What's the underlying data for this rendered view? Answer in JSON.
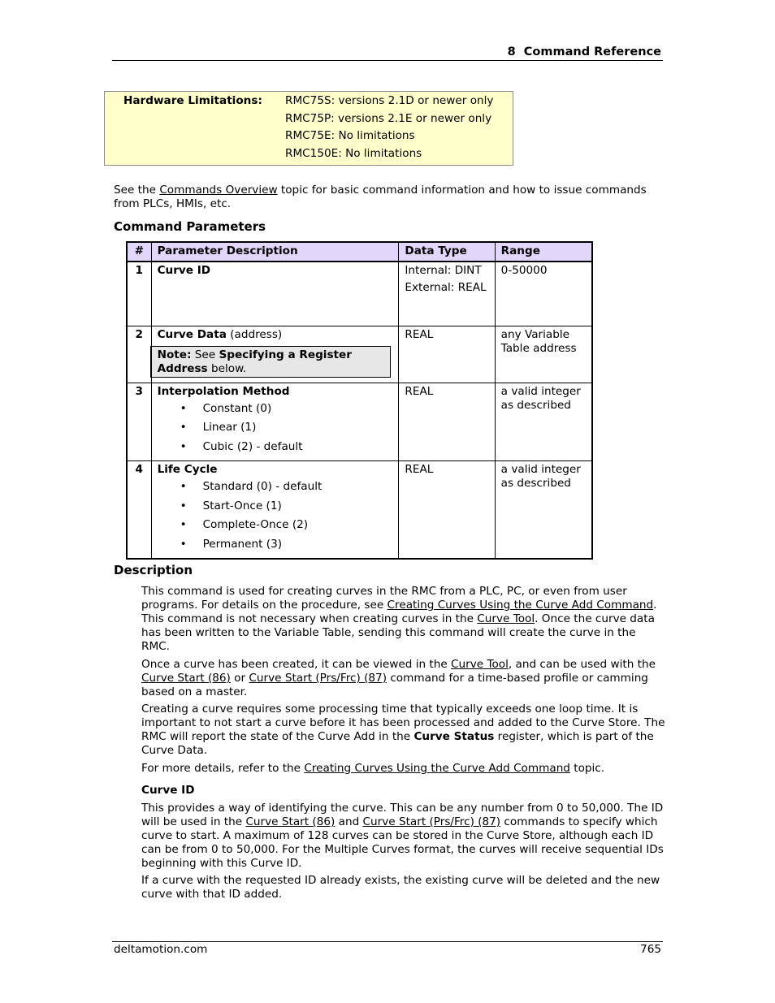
{
  "header": {
    "chapter_title": "8  Command Reference"
  },
  "hardware": {
    "label": "Hardware Limitations:",
    "items": [
      "RMC75S: versions 2.1D or newer only",
      "RMC75P: versions 2.1E or newer only",
      "RMC75E: No limitations",
      "RMC150E: No limitations"
    ]
  },
  "intro": {
    "before": "See the ",
    "link": "Commands Overview",
    "after": " topic for basic command information and how to issue commands from PLCs, HMIs, etc."
  },
  "command_parameters": {
    "heading": "Command Parameters",
    "columns": [
      "#",
      "Parameter Description",
      "Data Type",
      "Range"
    ],
    "rows": [
      {
        "num": "1",
        "name": "Curve ID",
        "data_type": [
          "Internal: DINT",
          "External: REAL"
        ],
        "range": "0-50000"
      },
      {
        "num": "2",
        "name": "Curve Data",
        "name_suffix": " (address)",
        "note": {
          "label": "Note:",
          "pre": " See ",
          "bold": "Specifying a Register Address",
          "post": " below."
        },
        "data_type": [
          "REAL"
        ],
        "range": "any Variable Table address"
      },
      {
        "num": "3",
        "name": "Interpolation Method",
        "options": [
          "Constant (0)",
          "Linear (1)",
          "Cubic (2) - default"
        ],
        "data_type": [
          "REAL"
        ],
        "range": "a valid integer as described"
      },
      {
        "num": "4",
        "name": "Life Cycle",
        "options": [
          "Standard (0) - default",
          "Start-Once (1)",
          "Complete-Once (2)",
          "Permanent (3)"
        ],
        "data_type": [
          "REAL"
        ],
        "range": "a valid integer as described"
      }
    ]
  },
  "description": {
    "heading": "Description",
    "p1": {
      "t1": "This command is used for creating curves in the RMC from a PLC, PC, or even from user programs. For details on the procedure, see ",
      "l1": "Creating Curves Using the Curve Add Command",
      "t2": ". This command is not necessary when creating curves in the ",
      "l2": "Curve Tool",
      "t3": ". Once the curve data has been written to the Variable Table, sending this command will create the curve in the RMC."
    },
    "p2": {
      "t1": "Once a curve has been created, it can be viewed in the ",
      "l1": "Curve Tool",
      "t2": ", and can be used with the ",
      "l2": "Curve Start (86)",
      "t3": " or ",
      "l3": "Curve Start (Prs/Frc) (87)",
      "t4": " command for a time-based profile or camming based on a master."
    },
    "p3": {
      "t1": "Creating a curve requires some processing time that typically exceeds one loop time. It is important to not start a curve before it has been processed and added to the Curve Store. The RMC will report the state of the Curve Add in the ",
      "b1": "Curve Status",
      "t2": " register, which is part of the Curve Data."
    },
    "p4": {
      "t1": "For more details, refer to the ",
      "l1": "Creating Curves Using the Curve Add Command",
      "t2": " topic."
    },
    "curve_id_heading": "Curve ID",
    "p5": {
      "t1": "This provides a way of identifying the curve. This can be any number from 0 to 50,000. The ID will be used in the ",
      "l1": "Curve Start (86)",
      "t2": " and ",
      "l2": "Curve Start (Prs/Frc) (87)",
      "t3": " commands to specify which curve to start. A maximum of 128 curves can be stored in the Curve Store, although each ID can be from 0 to 50,000. For the Multiple Curves format, the curves will receive sequential IDs beginning with this Curve ID."
    },
    "p6": "If a curve with the requested ID already exists, the existing curve will be deleted and the new curve with that ID added."
  },
  "footer": {
    "site": "deltamotion.com",
    "page_number": "765"
  },
  "icons": {
    "bullet": "•"
  }
}
